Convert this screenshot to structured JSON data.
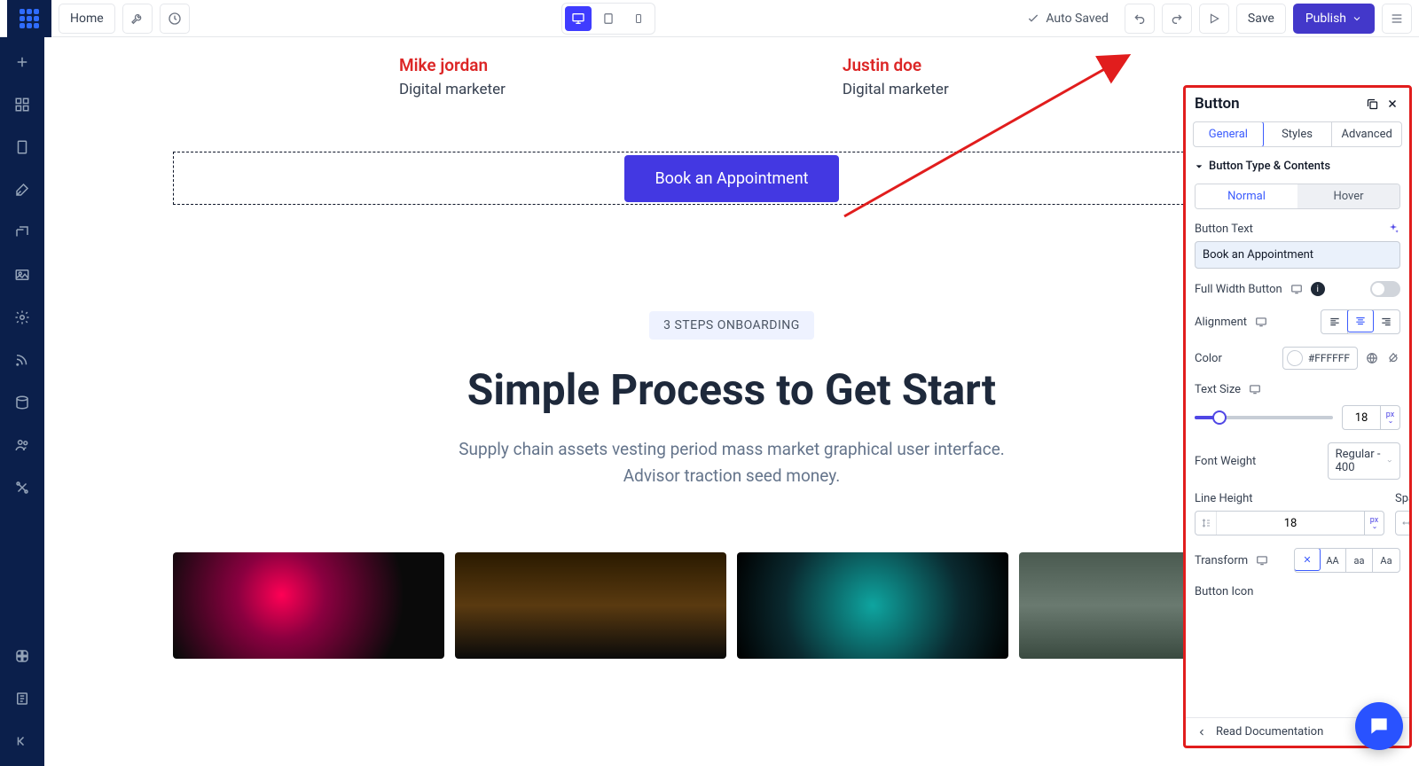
{
  "topbar": {
    "home": "Home",
    "autosaved": "Auto Saved",
    "save": "Save",
    "publish": "Publish"
  },
  "canvas": {
    "team": [
      {
        "name": "Mike jordan",
        "role": "Digital marketer"
      },
      {
        "name": "Justin doe",
        "role": "Digital marketer"
      }
    ],
    "cta": "Book an Appointment",
    "badge": "3 STEPS ONBOARDING",
    "heading": "Simple Process to Get Start",
    "subtext": "Supply chain assets vesting period mass market graphical user interface. Advisor traction seed money."
  },
  "panel": {
    "title": "Button",
    "tabs": {
      "general": "General",
      "styles": "Styles",
      "advanced": "Advanced"
    },
    "section_type": "Button Type & Contents",
    "state": {
      "normal": "Normal",
      "hover": "Hover"
    },
    "button_text_label": "Button Text",
    "button_text_value": "Book an Appointment",
    "full_width_label": "Full Width Button",
    "alignment_label": "Alignment",
    "color_label": "Color",
    "color_value": "#FFFFFF",
    "text_size_label": "Text Size",
    "text_size_value": "18",
    "font_weight_label": "Font Weight",
    "font_weight_value": "Regular - 400",
    "line_height_label": "Line Height",
    "line_height_value": "18",
    "spacing_label": "Spacing",
    "transform_label": "Transform",
    "transform_opts": {
      "none": "✕",
      "upper": "AA",
      "lower": "aa",
      "cap": "Aa"
    },
    "button_icon_label": "Button Icon",
    "footer": "Read Documentation",
    "unit_px": "px"
  }
}
